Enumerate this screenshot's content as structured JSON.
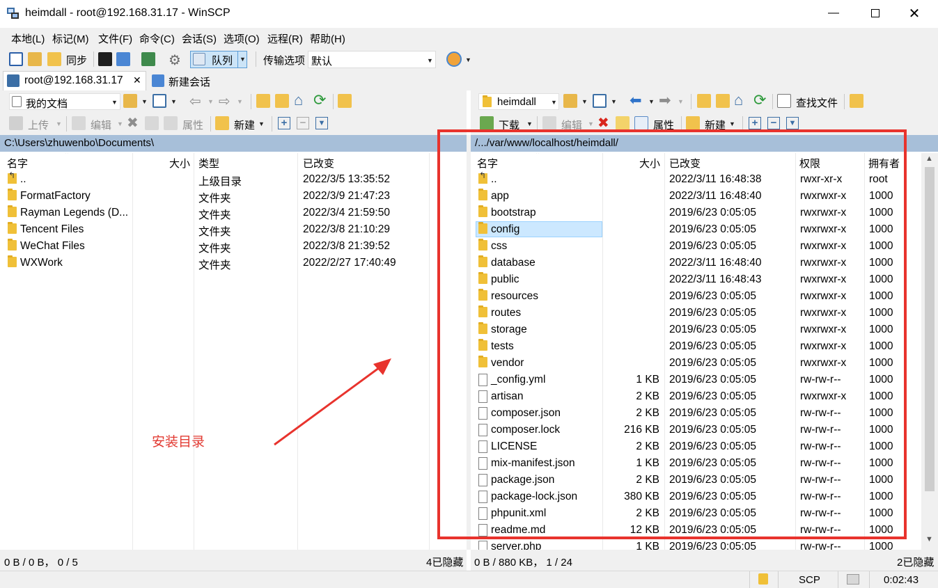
{
  "window": {
    "title": "heimdall - root@192.168.31.17 - WinSCP"
  },
  "menu": [
    "本地(L)",
    "标记(M)",
    "文件(F)",
    "命令(C)",
    "会话(S)",
    "选项(O)",
    "远程(R)",
    "帮助(H)"
  ],
  "toolbar": {
    "sync": "同步",
    "queue": "队列",
    "transfer_label": "传输选项",
    "transfer_value": "默认"
  },
  "tabs": {
    "session": "root@192.168.31.17",
    "new_session": "新建会话"
  },
  "left": {
    "location": "我的文档",
    "upload": "上传",
    "edit": "编辑",
    "properties": "属性",
    "new": "新建",
    "path": "C:\\Users\\zhuwenbo\\Documents\\",
    "columns": [
      "名字",
      "大小",
      "类型",
      "已改变"
    ],
    "rows": [
      {
        "name": "..",
        "size": "",
        "type": "上级目录",
        "changed": "2022/3/5  13:35:52",
        "kind": "up"
      },
      {
        "name": "FormatFactory",
        "size": "",
        "type": "文件夹",
        "changed": "2022/3/9  21:47:23",
        "kind": "folder"
      },
      {
        "name": "Rayman Legends (D...",
        "size": "",
        "type": "文件夹",
        "changed": "2022/3/4  21:59:50",
        "kind": "folder"
      },
      {
        "name": "Tencent Files",
        "size": "",
        "type": "文件夹",
        "changed": "2022/3/8  21:10:29",
        "kind": "folder"
      },
      {
        "name": "WeChat Files",
        "size": "",
        "type": "文件夹",
        "changed": "2022/3/8  21:39:52",
        "kind": "folder"
      },
      {
        "name": "WXWork",
        "size": "",
        "type": "文件夹",
        "changed": "2022/2/27  17:40:49",
        "kind": "folder"
      }
    ],
    "status": "0 B / 0 B，  0 / 5",
    "hidden": "4已隐藏"
  },
  "right": {
    "location": "heimdall",
    "find": "查找文件",
    "download": "下载",
    "edit": "编辑",
    "properties": "属性",
    "new": "新建",
    "path": "/.../var/www/localhost/heimdall/",
    "columns": [
      "名字",
      "大小",
      "已改变",
      "权限",
      "拥有者"
    ],
    "rows": [
      {
        "name": "..",
        "size": "",
        "changed": "2022/3/11 16:48:38",
        "rights": "rwxr-xr-x",
        "owner": "root",
        "kind": "up"
      },
      {
        "name": "app",
        "size": "",
        "changed": "2022/3/11 16:48:40",
        "rights": "rwxrwxr-x",
        "owner": "1000",
        "kind": "folder"
      },
      {
        "name": "bootstrap",
        "size": "",
        "changed": "2019/6/23 0:05:05",
        "rights": "rwxrwxr-x",
        "owner": "1000",
        "kind": "folder"
      },
      {
        "name": "config",
        "size": "",
        "changed": "2019/6/23 0:05:05",
        "rights": "rwxrwxr-x",
        "owner": "1000",
        "kind": "folder",
        "selected": true
      },
      {
        "name": "css",
        "size": "",
        "changed": "2019/6/23 0:05:05",
        "rights": "rwxrwxr-x",
        "owner": "1000",
        "kind": "folder"
      },
      {
        "name": "database",
        "size": "",
        "changed": "2022/3/11 16:48:40",
        "rights": "rwxrwxr-x",
        "owner": "1000",
        "kind": "folder"
      },
      {
        "name": "public",
        "size": "",
        "changed": "2022/3/11 16:48:43",
        "rights": "rwxrwxr-x",
        "owner": "1000",
        "kind": "folder"
      },
      {
        "name": "resources",
        "size": "",
        "changed": "2019/6/23 0:05:05",
        "rights": "rwxrwxr-x",
        "owner": "1000",
        "kind": "folder"
      },
      {
        "name": "routes",
        "size": "",
        "changed": "2019/6/23 0:05:05",
        "rights": "rwxrwxr-x",
        "owner": "1000",
        "kind": "folder"
      },
      {
        "name": "storage",
        "size": "",
        "changed": "2019/6/23 0:05:05",
        "rights": "rwxrwxr-x",
        "owner": "1000",
        "kind": "folder"
      },
      {
        "name": "tests",
        "size": "",
        "changed": "2019/6/23 0:05:05",
        "rights": "rwxrwxr-x",
        "owner": "1000",
        "kind": "folder"
      },
      {
        "name": "vendor",
        "size": "",
        "changed": "2019/6/23 0:05:05",
        "rights": "rwxrwxr-x",
        "owner": "1000",
        "kind": "folder"
      },
      {
        "name": "_config.yml",
        "size": "1 KB",
        "changed": "2019/6/23 0:05:05",
        "rights": "rw-rw-r--",
        "owner": "1000",
        "kind": "file"
      },
      {
        "name": "artisan",
        "size": "2 KB",
        "changed": "2019/6/23 0:05:05",
        "rights": "rwxrwxr-x",
        "owner": "1000",
        "kind": "file"
      },
      {
        "name": "composer.json",
        "size": "2 KB",
        "changed": "2019/6/23 0:05:05",
        "rights": "rw-rw-r--",
        "owner": "1000",
        "kind": "file"
      },
      {
        "name": "composer.lock",
        "size": "216 KB",
        "changed": "2019/6/23 0:05:05",
        "rights": "rw-rw-r--",
        "owner": "1000",
        "kind": "file"
      },
      {
        "name": "LICENSE",
        "size": "2 KB",
        "changed": "2019/6/23 0:05:05",
        "rights": "rw-rw-r--",
        "owner": "1000",
        "kind": "file"
      },
      {
        "name": "mix-manifest.json",
        "size": "1 KB",
        "changed": "2019/6/23 0:05:05",
        "rights": "rw-rw-r--",
        "owner": "1000",
        "kind": "file"
      },
      {
        "name": "package.json",
        "size": "2 KB",
        "changed": "2019/6/23 0:05:05",
        "rights": "rw-rw-r--",
        "owner": "1000",
        "kind": "file"
      },
      {
        "name": "package-lock.json",
        "size": "380 KB",
        "changed": "2019/6/23 0:05:05",
        "rights": "rw-rw-r--",
        "owner": "1000",
        "kind": "file"
      },
      {
        "name": "phpunit.xml",
        "size": "2 KB",
        "changed": "2019/6/23 0:05:05",
        "rights": "rw-rw-r--",
        "owner": "1000",
        "kind": "file"
      },
      {
        "name": "readme.md",
        "size": "12 KB",
        "changed": "2019/6/23 0:05:05",
        "rights": "rw-rw-r--",
        "owner": "1000",
        "kind": "file"
      },
      {
        "name": "server.php",
        "size": "1 KB",
        "changed": "2019/6/23 0:05:05",
        "rights": "rw-rw-r--",
        "owner": "1000",
        "kind": "file"
      }
    ],
    "status": "0 B / 880 KB，  1 / 24",
    "hidden": "2已隐藏"
  },
  "bottom": {
    "protocol": "SCP",
    "time": "0:02:43"
  },
  "annotation": "安装目录",
  "colors": {
    "accent": "#a7bfd9",
    "annotation": "#e23a32",
    "selection": "#cce8ff"
  }
}
